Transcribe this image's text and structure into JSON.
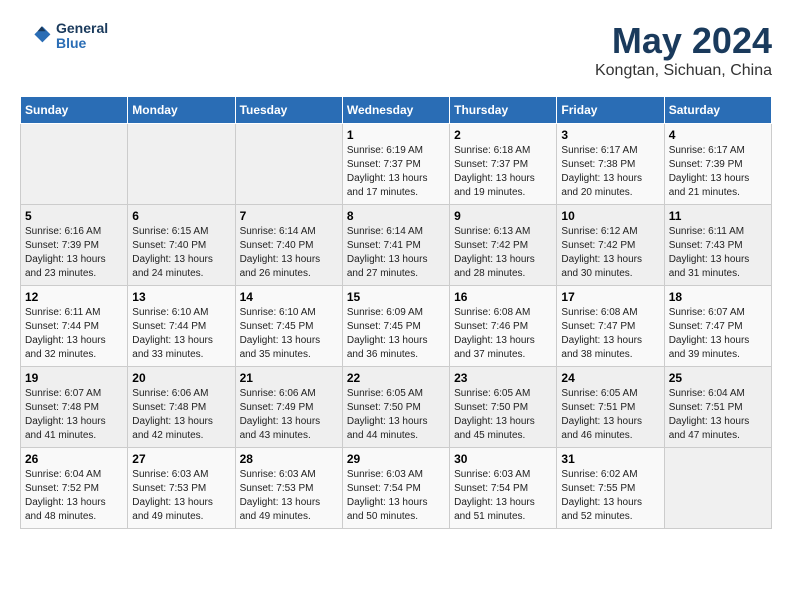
{
  "header": {
    "logo_line1": "General",
    "logo_line2": "Blue",
    "main_title": "May 2024",
    "subtitle": "Kongtan, Sichuan, China"
  },
  "weekdays": [
    "Sunday",
    "Monday",
    "Tuesday",
    "Wednesday",
    "Thursday",
    "Friday",
    "Saturday"
  ],
  "weeks": [
    [
      {
        "day": "",
        "sunrise": "",
        "sunset": "",
        "daylight": ""
      },
      {
        "day": "",
        "sunrise": "",
        "sunset": "",
        "daylight": ""
      },
      {
        "day": "",
        "sunrise": "",
        "sunset": "",
        "daylight": ""
      },
      {
        "day": "1",
        "sunrise": "Sunrise: 6:19 AM",
        "sunset": "Sunset: 7:37 PM",
        "daylight": "Daylight: 13 hours and 17 minutes."
      },
      {
        "day": "2",
        "sunrise": "Sunrise: 6:18 AM",
        "sunset": "Sunset: 7:37 PM",
        "daylight": "Daylight: 13 hours and 19 minutes."
      },
      {
        "day": "3",
        "sunrise": "Sunrise: 6:17 AM",
        "sunset": "Sunset: 7:38 PM",
        "daylight": "Daylight: 13 hours and 20 minutes."
      },
      {
        "day": "4",
        "sunrise": "Sunrise: 6:17 AM",
        "sunset": "Sunset: 7:39 PM",
        "daylight": "Daylight: 13 hours and 21 minutes."
      }
    ],
    [
      {
        "day": "5",
        "sunrise": "Sunrise: 6:16 AM",
        "sunset": "Sunset: 7:39 PM",
        "daylight": "Daylight: 13 hours and 23 minutes."
      },
      {
        "day": "6",
        "sunrise": "Sunrise: 6:15 AM",
        "sunset": "Sunset: 7:40 PM",
        "daylight": "Daylight: 13 hours and 24 minutes."
      },
      {
        "day": "7",
        "sunrise": "Sunrise: 6:14 AM",
        "sunset": "Sunset: 7:40 PM",
        "daylight": "Daylight: 13 hours and 26 minutes."
      },
      {
        "day": "8",
        "sunrise": "Sunrise: 6:14 AM",
        "sunset": "Sunset: 7:41 PM",
        "daylight": "Daylight: 13 hours and 27 minutes."
      },
      {
        "day": "9",
        "sunrise": "Sunrise: 6:13 AM",
        "sunset": "Sunset: 7:42 PM",
        "daylight": "Daylight: 13 hours and 28 minutes."
      },
      {
        "day": "10",
        "sunrise": "Sunrise: 6:12 AM",
        "sunset": "Sunset: 7:42 PM",
        "daylight": "Daylight: 13 hours and 30 minutes."
      },
      {
        "day": "11",
        "sunrise": "Sunrise: 6:11 AM",
        "sunset": "Sunset: 7:43 PM",
        "daylight": "Daylight: 13 hours and 31 minutes."
      }
    ],
    [
      {
        "day": "12",
        "sunrise": "Sunrise: 6:11 AM",
        "sunset": "Sunset: 7:44 PM",
        "daylight": "Daylight: 13 hours and 32 minutes."
      },
      {
        "day": "13",
        "sunrise": "Sunrise: 6:10 AM",
        "sunset": "Sunset: 7:44 PM",
        "daylight": "Daylight: 13 hours and 33 minutes."
      },
      {
        "day": "14",
        "sunrise": "Sunrise: 6:10 AM",
        "sunset": "Sunset: 7:45 PM",
        "daylight": "Daylight: 13 hours and 35 minutes."
      },
      {
        "day": "15",
        "sunrise": "Sunrise: 6:09 AM",
        "sunset": "Sunset: 7:45 PM",
        "daylight": "Daylight: 13 hours and 36 minutes."
      },
      {
        "day": "16",
        "sunrise": "Sunrise: 6:08 AM",
        "sunset": "Sunset: 7:46 PM",
        "daylight": "Daylight: 13 hours and 37 minutes."
      },
      {
        "day": "17",
        "sunrise": "Sunrise: 6:08 AM",
        "sunset": "Sunset: 7:47 PM",
        "daylight": "Daylight: 13 hours and 38 minutes."
      },
      {
        "day": "18",
        "sunrise": "Sunrise: 6:07 AM",
        "sunset": "Sunset: 7:47 PM",
        "daylight": "Daylight: 13 hours and 39 minutes."
      }
    ],
    [
      {
        "day": "19",
        "sunrise": "Sunrise: 6:07 AM",
        "sunset": "Sunset: 7:48 PM",
        "daylight": "Daylight: 13 hours and 41 minutes."
      },
      {
        "day": "20",
        "sunrise": "Sunrise: 6:06 AM",
        "sunset": "Sunset: 7:48 PM",
        "daylight": "Daylight: 13 hours and 42 minutes."
      },
      {
        "day": "21",
        "sunrise": "Sunrise: 6:06 AM",
        "sunset": "Sunset: 7:49 PM",
        "daylight": "Daylight: 13 hours and 43 minutes."
      },
      {
        "day": "22",
        "sunrise": "Sunrise: 6:05 AM",
        "sunset": "Sunset: 7:50 PM",
        "daylight": "Daylight: 13 hours and 44 minutes."
      },
      {
        "day": "23",
        "sunrise": "Sunrise: 6:05 AM",
        "sunset": "Sunset: 7:50 PM",
        "daylight": "Daylight: 13 hours and 45 minutes."
      },
      {
        "day": "24",
        "sunrise": "Sunrise: 6:05 AM",
        "sunset": "Sunset: 7:51 PM",
        "daylight": "Daylight: 13 hours and 46 minutes."
      },
      {
        "day": "25",
        "sunrise": "Sunrise: 6:04 AM",
        "sunset": "Sunset: 7:51 PM",
        "daylight": "Daylight: 13 hours and 47 minutes."
      }
    ],
    [
      {
        "day": "26",
        "sunrise": "Sunrise: 6:04 AM",
        "sunset": "Sunset: 7:52 PM",
        "daylight": "Daylight: 13 hours and 48 minutes."
      },
      {
        "day": "27",
        "sunrise": "Sunrise: 6:03 AM",
        "sunset": "Sunset: 7:53 PM",
        "daylight": "Daylight: 13 hours and 49 minutes."
      },
      {
        "day": "28",
        "sunrise": "Sunrise: 6:03 AM",
        "sunset": "Sunset: 7:53 PM",
        "daylight": "Daylight: 13 hours and 49 minutes."
      },
      {
        "day": "29",
        "sunrise": "Sunrise: 6:03 AM",
        "sunset": "Sunset: 7:54 PM",
        "daylight": "Daylight: 13 hours and 50 minutes."
      },
      {
        "day": "30",
        "sunrise": "Sunrise: 6:03 AM",
        "sunset": "Sunset: 7:54 PM",
        "daylight": "Daylight: 13 hours and 51 minutes."
      },
      {
        "day": "31",
        "sunrise": "Sunrise: 6:02 AM",
        "sunset": "Sunset: 7:55 PM",
        "daylight": "Daylight: 13 hours and 52 minutes."
      },
      {
        "day": "",
        "sunrise": "",
        "sunset": "",
        "daylight": ""
      }
    ]
  ]
}
